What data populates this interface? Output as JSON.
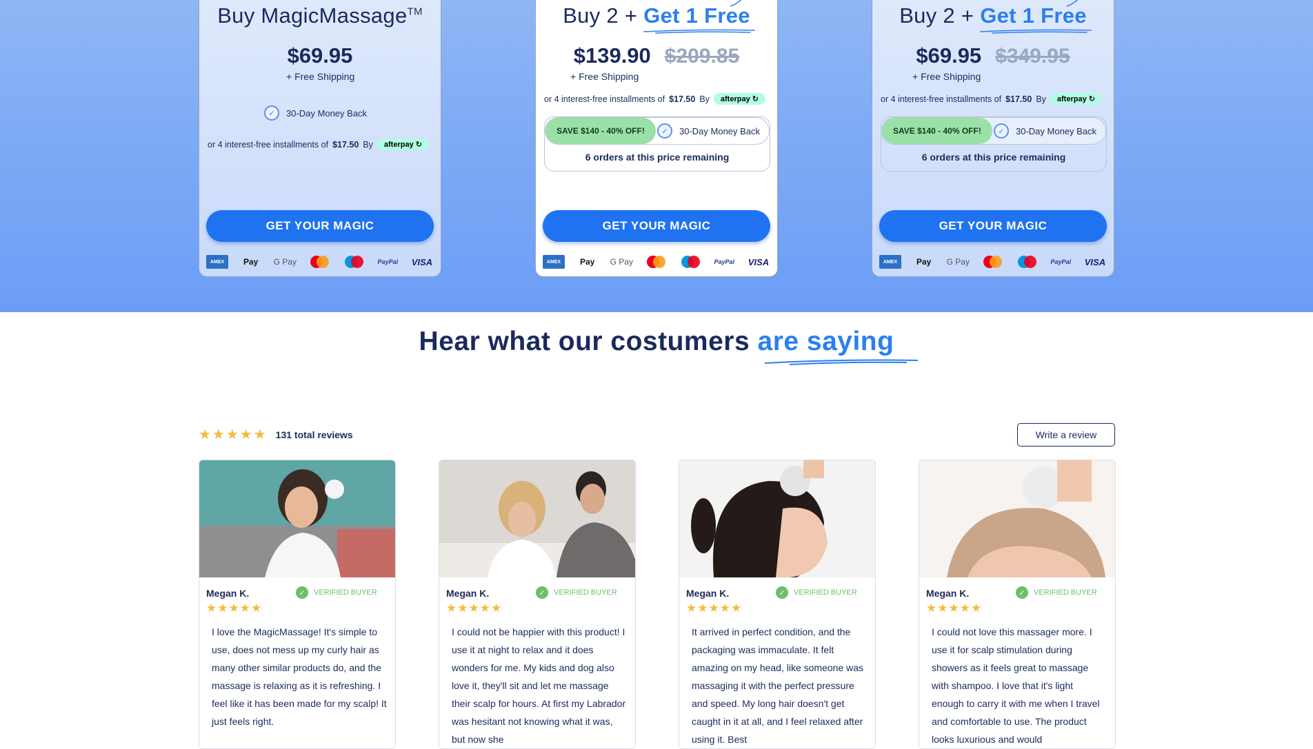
{
  "plans": [
    {
      "title": "Buy MagicMassage",
      "title_tm": "TM",
      "price": "$69.95",
      "shipping": "+ Free Shipping",
      "money_back": "30-Day Money Back",
      "installments_prefix": "or 4 interest-free installments of",
      "installments_amount": "$17.50",
      "installments_by": "By",
      "afterpay": "afterpay",
      "cta": "GET YOUR MAGIC"
    },
    {
      "title_prefix": "Buy 2 + ",
      "title_highlight": "Get 1 Free",
      "price": "$139.90",
      "old_price": "$209.85",
      "shipping": "+ Free Shipping",
      "installments_prefix": "or 4 interest-free installments of",
      "installments_amount": "$17.50",
      "installments_by": "By",
      "afterpay": "afterpay",
      "save": "SAVE $140 - 40% OFF!",
      "money_back": "30-Day Money Back",
      "remaining": "6 orders at this price remaining",
      "cta": "GET YOUR MAGIC"
    },
    {
      "title_prefix": "Buy 2 + ",
      "title_highlight": "Get 1 Free",
      "price": "$69.95",
      "old_price": "$349.95",
      "shipping": "+ Free Shipping",
      "installments_prefix": "or 4 interest-free installments of",
      "installments_amount": "$17.50",
      "installments_by": "By",
      "afterpay": "afterpay",
      "save": "SAVE $140 - 40% OFF!",
      "money_back": "30-Day Money Back",
      "remaining": "6 orders at this price remaining",
      "cta": "GET YOUR MAGIC"
    }
  ],
  "payment_methods": {
    "amex": "AMEX",
    "apple": "Pay",
    "gpay": "G Pay",
    "paypal": "PayPal",
    "visa": "VISA",
    "maestro": "Maestro"
  },
  "reviews_section": {
    "title_prefix": "Hear what our costumers ",
    "title_highlight": "are saying",
    "stars": "★★★★★",
    "total": "131 total reviews",
    "write_review": "Write a review"
  },
  "reviews": [
    {
      "name": "Megan K.",
      "verified": "VERIFIED BUYER",
      "stars": "★★★★★",
      "text": "I love the MagicMassage! It's simple to use, does not mess up my curly hair as many other similar products do, and the massage is relaxing as it is refreshing. I feel like it has been made for my scalp! It just feels right."
    },
    {
      "name": "Megan K.",
      "verified": "VERIFIED BUYER",
      "stars": "★★★★★",
      "text": "I could not be happier with this product! I use it at night to relax and it does wonders for me. My kids and dog also love it, they'll sit and let me massage their scalp for hours. At first my Labrador was hesitant not knowing what it was, but now she"
    },
    {
      "name": "Megan K.",
      "verified": "VERIFIED BUYER",
      "stars": "★★★★★",
      "text": "It arrived in perfect condition, and the packaging was immaculate. It felt amazing on my head, like someone was massaging it with the perfect pressure and speed. My long hair doesn't get caught in it at all, and I feel relaxed after using it. Best"
    },
    {
      "name": "Megan K.",
      "verified": "VERIFIED BUYER",
      "stars": "★★★★★",
      "text": "I could not love this massager more. I use it for scalp stimulation during showers as it feels great to massage with shampoo. I love that it's light enough to carry it with me when I travel and comfortable to use. The product looks luxurious and would"
    }
  ],
  "colors": {
    "accent": "#2b7ff0",
    "cta": "#1f73f0",
    "navy": "#1b2a5c",
    "star": "#f6b93b",
    "verified": "#6dbd6b",
    "save_pill": "#9be0a6"
  }
}
